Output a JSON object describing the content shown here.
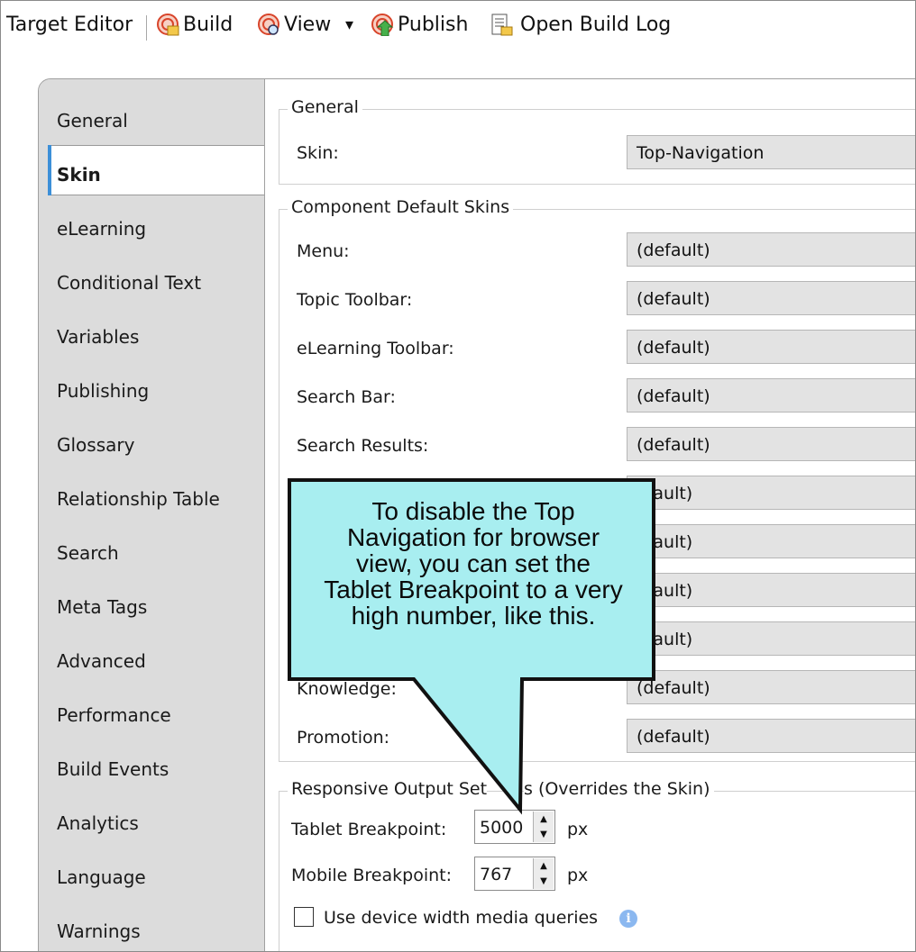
{
  "toolbar": {
    "title": "Target Editor",
    "build_label": "Build",
    "view_label": "View",
    "view_dropdown": "▾",
    "publish_label": "Publish",
    "open_build_log_label": "Open Build Log",
    "icons": [
      "build-icon",
      "view-icon",
      "publish-icon",
      "open-build-log-icon"
    ]
  },
  "nav": {
    "active": "Skin",
    "items": [
      "General",
      "Skin",
      "eLearning",
      "Conditional Text",
      "Variables",
      "Publishing",
      "Glossary",
      "Relationship Table",
      "Search",
      "Meta Tags",
      "Advanced",
      "Performance",
      "Build Events",
      "Analytics",
      "Language",
      "Warnings"
    ]
  },
  "general": {
    "title": "General",
    "skin_label": "Skin:",
    "skin_value": "Top-Navigation"
  },
  "component_skins": {
    "title": "Component Default Skins",
    "rows": [
      {
        "label": "Menu:",
        "value": "(default)"
      },
      {
        "label": "Topic Toolbar:",
        "value": "(default)"
      },
      {
        "label": "eLearning Toolbar:",
        "value": "(default)"
      },
      {
        "label": "Search Bar:",
        "value": "(default)"
      },
      {
        "label": "Search Results:",
        "value": "(default)"
      },
      {
        "label": "",
        "value": "efault)"
      },
      {
        "label": "",
        "value": "efault)"
      },
      {
        "label": "",
        "value": "efault)"
      },
      {
        "label": "",
        "value": "efault)"
      },
      {
        "label": "Knowledge:",
        "value": "(default)"
      },
      {
        "label": "Promotion:",
        "value": "(default)"
      }
    ]
  },
  "responsive": {
    "title": "Responsive Output Set",
    "title_tail": "s (Overrides the Skin)",
    "tablet_label": "Tablet Breakpoint:",
    "tablet_value": "5000",
    "mobile_label": "Mobile Breakpoint:",
    "mobile_value": "767",
    "unit": "px",
    "checkbox_label": "Use device width media queries",
    "checkbox_checked": false,
    "info_icon": "i"
  },
  "callout": {
    "lines": [
      "To disable the Top",
      "Navigation for browser",
      "view, you can set the",
      "Tablet Breakpoint to a very",
      "high number, like this."
    ],
    "fill_color": "#a8eef0",
    "border_color": "#111111"
  },
  "colors": {
    "nav_background": "#dcdcdc",
    "active_accent": "#3c8fd8",
    "combo_background": "#e3e3e3"
  }
}
